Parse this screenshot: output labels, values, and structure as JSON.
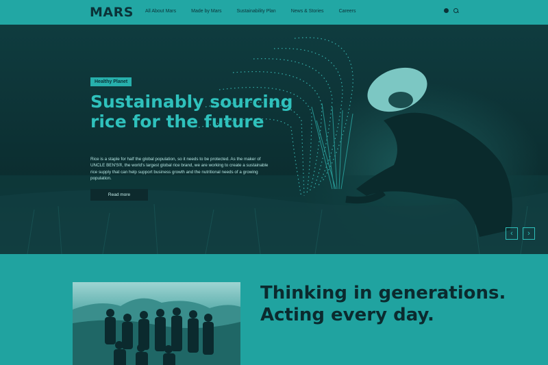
{
  "header": {
    "logo": "MARS",
    "nav": [
      "All About Mars",
      "Made by Mars",
      "Sustainability Plan",
      "News & Stories",
      "Careers"
    ]
  },
  "hero": {
    "tag": "Healthy Planet",
    "title": "Sustainably sourcing rice for the future",
    "body": "Rice is a staple for half the global population, so it needs to be protected. As the maker of UNCLE BEN'S®, the world's largest global rice brand, we are working to create a sustainable rice supply that can help support business growth and the nutritional needs of a growing population.",
    "cta": "Read more",
    "prev_icon": "‹",
    "next_icon": "›"
  },
  "section": {
    "title": "Thinking in generations. Acting every day."
  },
  "colors": {
    "accent": "#20a3a0",
    "dark": "#0b3238",
    "hero_title": "#2fc1bc"
  }
}
